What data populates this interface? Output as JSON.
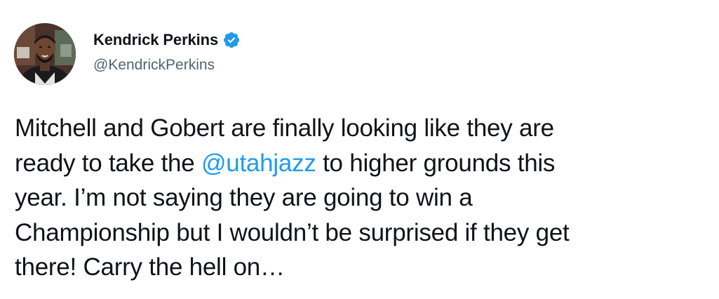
{
  "author": {
    "display_name": "Kendrick Perkins",
    "handle": "@KendrickPerkins",
    "verified_icon": "verified-badge-icon",
    "avatar_icon": "profile-photo"
  },
  "tweet": {
    "lines": [
      [
        "Mitchell and Gobert are finally looking like they are"
      ],
      [
        "ready to take the ",
        "@utahjazz",
        " to higher grounds this"
      ],
      [
        "year. I’m not saying they are going to win a"
      ],
      [
        "Championship but I wouldn’t be surprised if they get"
      ],
      [
        "there! Carry the hell on…"
      ]
    ]
  },
  "colors": {
    "text": "#0f1419",
    "secondary": "#536471",
    "accent": "#1d9bf0"
  }
}
